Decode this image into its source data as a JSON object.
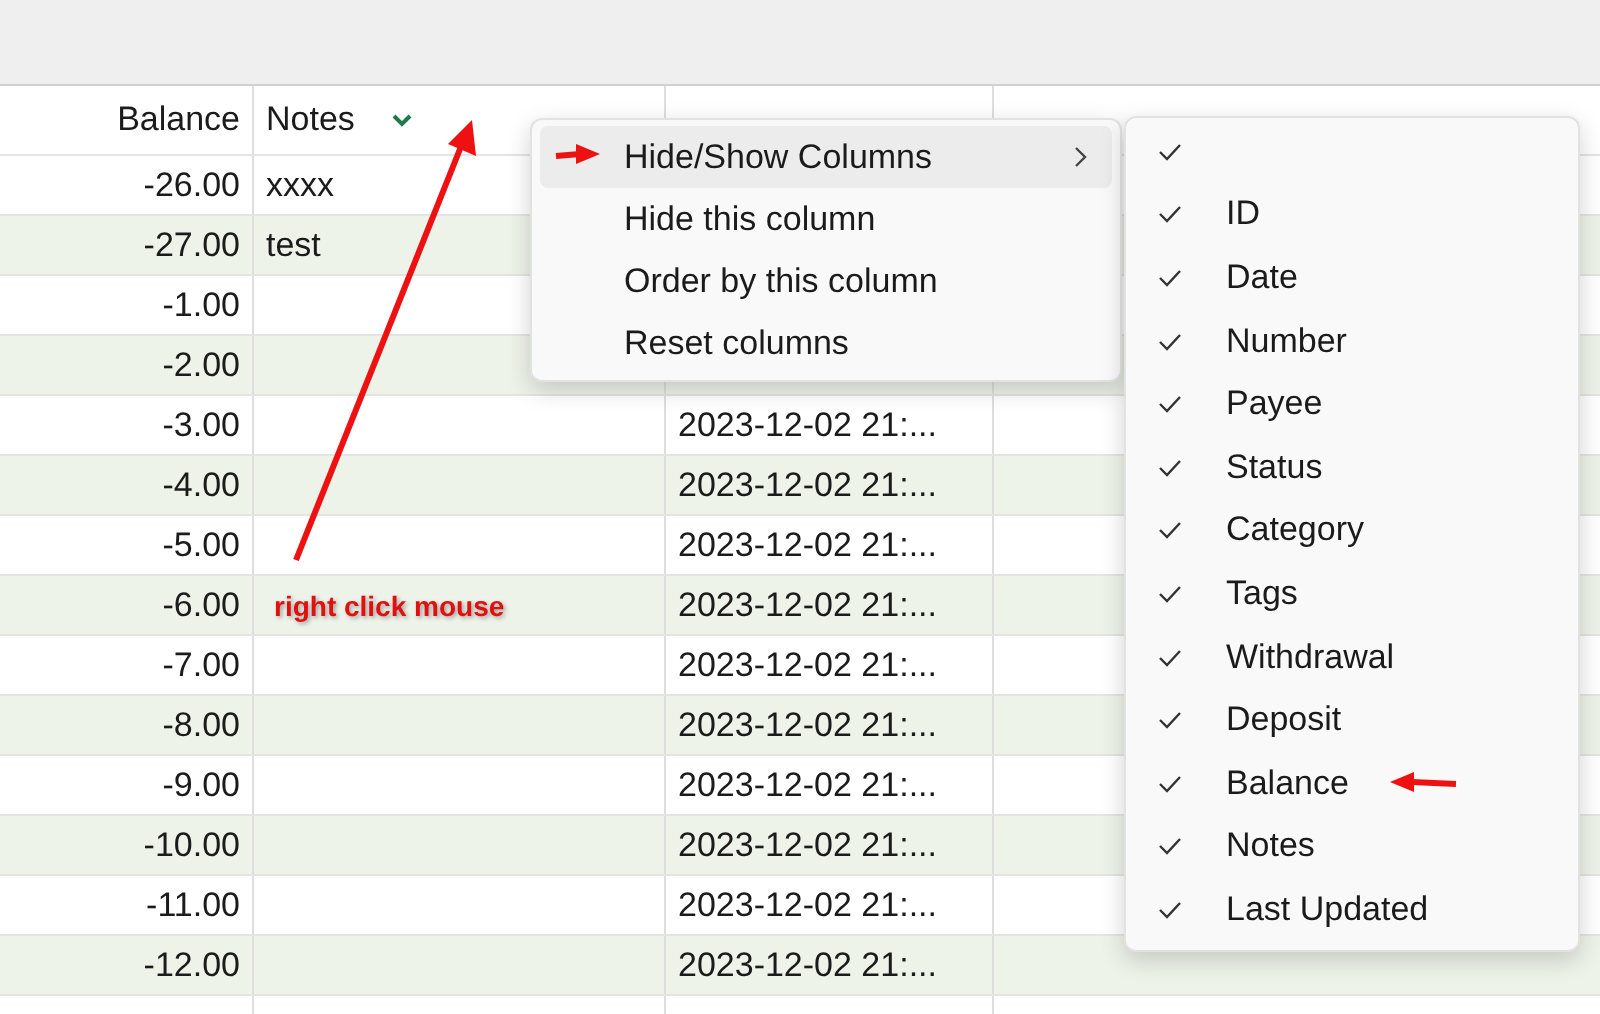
{
  "table": {
    "columns": [
      {
        "label": "Balance",
        "sorted": false
      },
      {
        "label": "Notes",
        "sorted": true
      }
    ],
    "rows": [
      {
        "balance": "-26.00",
        "notes": "xxxx"
      },
      {
        "balance": "-27.00",
        "notes": "test"
      },
      {
        "balance": "-1.00"
      },
      {
        "balance": "-2.00"
      },
      {
        "balance": "-3.00",
        "last_updated": "2023-12-02 21:..."
      },
      {
        "balance": "-4.00",
        "last_updated": "2023-12-02 21:..."
      },
      {
        "balance": "-5.00",
        "last_updated": "2023-12-02 21:..."
      },
      {
        "balance": "-6.00",
        "last_updated": "2023-12-02 21:..."
      },
      {
        "balance": "-7.00",
        "last_updated": "2023-12-02 21:..."
      },
      {
        "balance": "-8.00",
        "last_updated": "2023-12-02 21:..."
      },
      {
        "balance": "-9.00",
        "last_updated": "2023-12-02 21:..."
      },
      {
        "balance": "-10.00",
        "last_updated": "2023-12-02 21:..."
      },
      {
        "balance": "-11.00",
        "last_updated": "2023-12-02 21:..."
      },
      {
        "balance": "-12.00",
        "last_updated": "2023-12-02 21:..."
      }
    ]
  },
  "context_menu": {
    "items": [
      {
        "label": "Hide/Show Columns",
        "has_submenu": true,
        "selected": true
      },
      {
        "label": "Hide this column",
        "has_submenu": false,
        "selected": false
      },
      {
        "label": "Order by this column",
        "has_submenu": false,
        "selected": false
      },
      {
        "label": "Reset columns",
        "has_submenu": false,
        "selected": false
      }
    ]
  },
  "submenu": {
    "items": [
      {
        "checked": true
      },
      {
        "label": "ID",
        "checked": true
      },
      {
        "label": "Date",
        "checked": true
      },
      {
        "label": "Number",
        "checked": true
      },
      {
        "label": "Payee",
        "checked": true
      },
      {
        "label": "Status",
        "checked": true
      },
      {
        "label": "Category",
        "checked": true
      },
      {
        "label": "Tags",
        "checked": true
      },
      {
        "label": "Withdrawal",
        "checked": true
      },
      {
        "label": "Deposit",
        "checked": true
      },
      {
        "label": "Balance",
        "checked": true
      },
      {
        "label": "Notes",
        "checked": true
      },
      {
        "label": "Last Updated",
        "checked": true
      }
    ]
  },
  "annotation": {
    "text": "right click mouse"
  }
}
